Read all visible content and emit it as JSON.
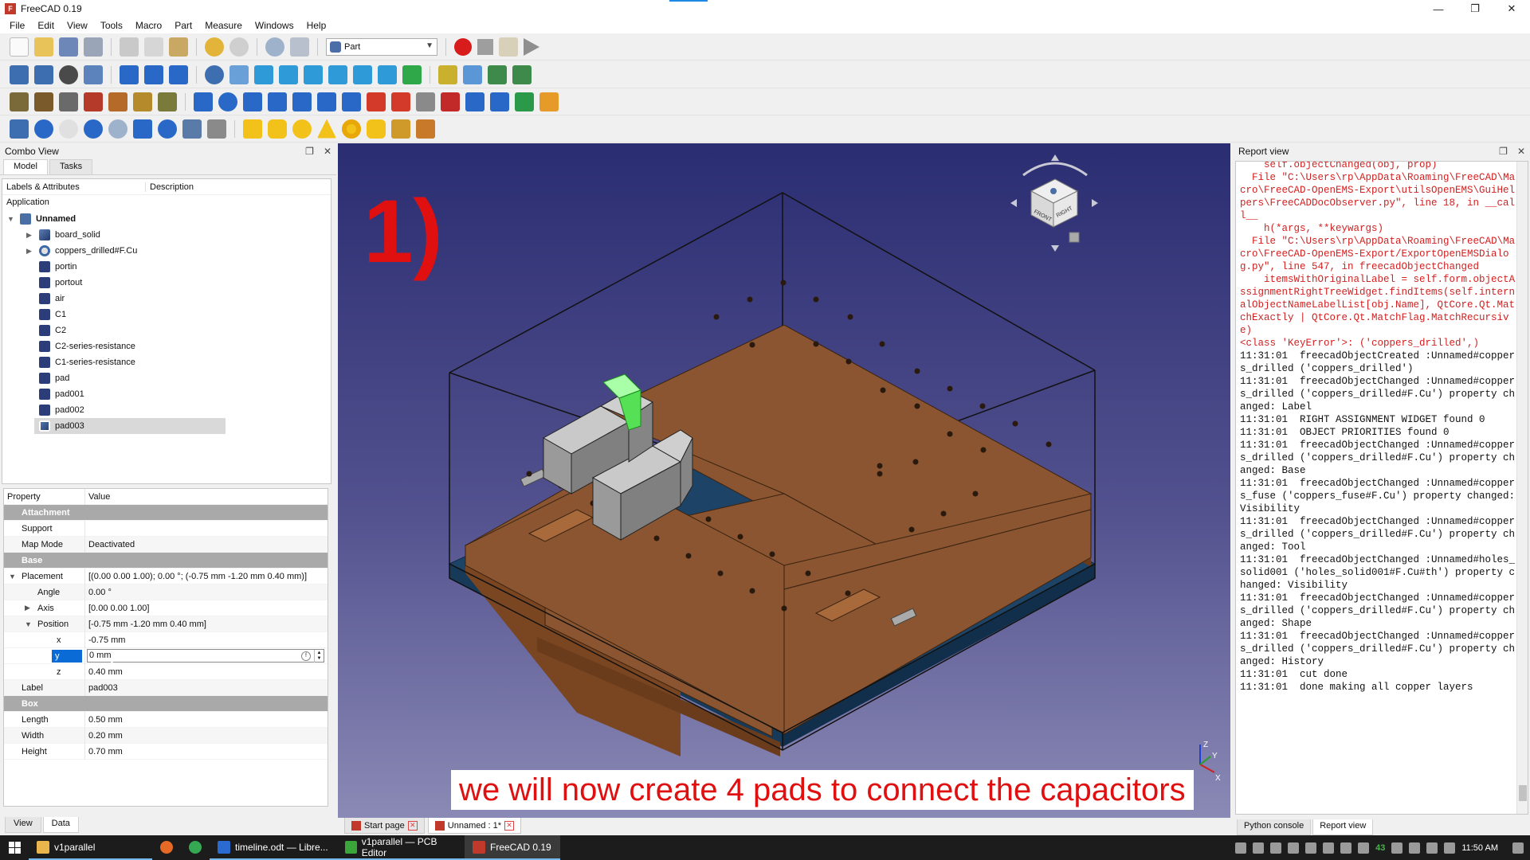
{
  "window": {
    "title": "FreeCAD 0.19",
    "controls": [
      "—",
      "❐",
      "✕"
    ]
  },
  "menu": [
    "File",
    "Edit",
    "View",
    "Tools",
    "Macro",
    "Part",
    "Measure",
    "Windows",
    "Help"
  ],
  "workbench": {
    "selected": "Part"
  },
  "combo_view": {
    "title": "Combo View",
    "tabs": [
      "Model",
      "Tasks"
    ],
    "tree_headers": [
      "Labels & Attributes",
      "Description"
    ],
    "application_label": "Application",
    "document": "Unnamed",
    "items": [
      {
        "label": "board_solid",
        "expandable": true
      },
      {
        "label": "coppers_drilled#F.Cu",
        "expandable": true
      },
      {
        "label": "portin"
      },
      {
        "label": "portout"
      },
      {
        "label": "air"
      },
      {
        "label": "C1"
      },
      {
        "label": "C2"
      },
      {
        "label": "C2-series-resistance"
      },
      {
        "label": "C1-series-resistance"
      },
      {
        "label": "pad"
      },
      {
        "label": "pad001"
      },
      {
        "label": "pad002"
      },
      {
        "label": "pad003",
        "selected": true
      }
    ],
    "bottom_tabs": [
      "View",
      "Data"
    ]
  },
  "property_editor": {
    "headers": [
      "Property",
      "Value"
    ],
    "groups": {
      "attachment": "Attachment",
      "base": "Base",
      "box": "Box"
    },
    "support": {
      "name": "Support",
      "value": ""
    },
    "map_mode": {
      "name": "Map Mode",
      "value": "Deactivated"
    },
    "placement": {
      "name": "Placement",
      "value": "[(0.00 0.00 1.00); 0.00 °; (-0.75 mm  -1.20 mm  0.40 mm)]"
    },
    "angle": {
      "name": "Angle",
      "value": "0.00 °"
    },
    "axis": {
      "name": "Axis",
      "value": "[0.00 0.00 1.00]"
    },
    "position": {
      "name": "Position",
      "value": "[-0.75 mm  -1.20 mm  0.40 mm]"
    },
    "x": {
      "name": "x",
      "value": "-0.75 mm"
    },
    "y": {
      "name": "y",
      "value": "0 mm"
    },
    "z": {
      "name": "z",
      "value": "0.40 mm"
    },
    "label": {
      "name": "Label",
      "value": "pad003"
    },
    "length": {
      "name": "Length",
      "value": "0.50 mm"
    },
    "width": {
      "name": "Width",
      "value": "0.20 mm"
    },
    "height": {
      "name": "Height",
      "value": "0.70 mm"
    }
  },
  "viewport": {
    "step_number": "1)",
    "subtitle": "we will now create 4 pads to connect the capacitors",
    "tabs": [
      {
        "label": "Start page"
      },
      {
        "label": "Unnamed : 1*",
        "active": true
      }
    ],
    "axis_labels": {
      "x": "X",
      "y": "Y",
      "z": "Z"
    },
    "nav_cube_faces": [
      "FRONT",
      "RIGHT"
    ]
  },
  "report_view": {
    "title": "Report view",
    "lines": [
      {
        "t": "    self.objectChanged(obj, prop)",
        "err": true
      },
      {
        "t": "  File \"C:\\Users\\rp\\AppData\\Roaming\\FreeCAD\\Macro\\FreeCAD-OpenEMS-Export\\utilsOpenEMS\\GuiHelpers\\FreeCADDocObserver.py\", line 18, in __call__",
        "err": true
      },
      {
        "t": "    h(*args, **keywargs)",
        "err": true
      },
      {
        "t": "  File \"C:\\Users\\rp\\AppData\\Roaming\\FreeCAD\\Macro\\FreeCAD-OpenEMS-Export/ExportOpenEMSDialog.py\", line 547, in freecadObjectChanged",
        "err": true
      },
      {
        "t": "    itemsWithOriginalLabel = self.form.objectAssignmentRightTreeWidget.findItems(self.internalObjectNameLabelList[obj.Name], QtCore.Qt.MatchExactly | QtCore.Qt.MatchFlag.MatchRecursive)",
        "err": true
      },
      {
        "t": "<class 'KeyError'>: ('coppers_drilled',)",
        "err": true
      },
      {
        "t": "11:31:01  freecadObjectCreated :Unnamed#coppers_drilled ('coppers_drilled')"
      },
      {
        "t": "11:31:01  freecadObjectChanged :Unnamed#coppers_drilled ('coppers_drilled#F.Cu') property changed: Label"
      },
      {
        "t": "11:31:01  RIGHT ASSIGNMENT WIDGET found 0"
      },
      {
        "t": "11:31:01  OBJECT PRIORITIES found 0"
      },
      {
        "t": "11:31:01  freecadObjectChanged :Unnamed#coppers_drilled ('coppers_drilled#F.Cu') property changed: Base"
      },
      {
        "t": "11:31:01  freecadObjectChanged :Unnamed#coppers_fuse ('coppers_fuse#F.Cu') property changed: Visibility"
      },
      {
        "t": "11:31:01  freecadObjectChanged :Unnamed#coppers_drilled ('coppers_drilled#F.Cu') property changed: Tool"
      },
      {
        "t": "11:31:01  freecadObjectChanged :Unnamed#holes_solid001 ('holes_solid001#F.Cu#th') property changed: Visibility"
      },
      {
        "t": "11:31:01  freecadObjectChanged :Unnamed#coppers_drilled ('coppers_drilled#F.Cu') property changed: Shape"
      },
      {
        "t": "11:31:01  freecadObjectChanged :Unnamed#coppers_drilled ('coppers_drilled#F.Cu') property changed: History"
      },
      {
        "t": "11:31:01  cut done"
      },
      {
        "t": "11:31:01  done making all copper layers"
      }
    ],
    "tabs": [
      "Python console",
      "Report view"
    ]
  },
  "taskbar": {
    "items": [
      {
        "label": "v1parallel",
        "icon_color": "#e8b64a"
      },
      {
        "label": "",
        "icon_color": "#e66a25"
      },
      {
        "label": "",
        "icon_color": "#34a853"
      },
      {
        "label": "timeline.odt — Libre...",
        "icon_color": "#2a6ad1"
      },
      {
        "label": "v1parallel — PCB Editor",
        "icon_color": "#3aa63a"
      },
      {
        "label": "FreeCAD 0.19",
        "icon_color": "#c0392b",
        "active": true
      }
    ],
    "tray_number": "43",
    "time": "11:50 AM"
  },
  "colors": {
    "viewport_top": "#2b2d72",
    "viewport_bottom": "#8b89b5",
    "board_copper": "#8a5530",
    "board_base": "#1d4466",
    "highlight_green": "#66ee66",
    "subtitle_red": "#e01010"
  }
}
